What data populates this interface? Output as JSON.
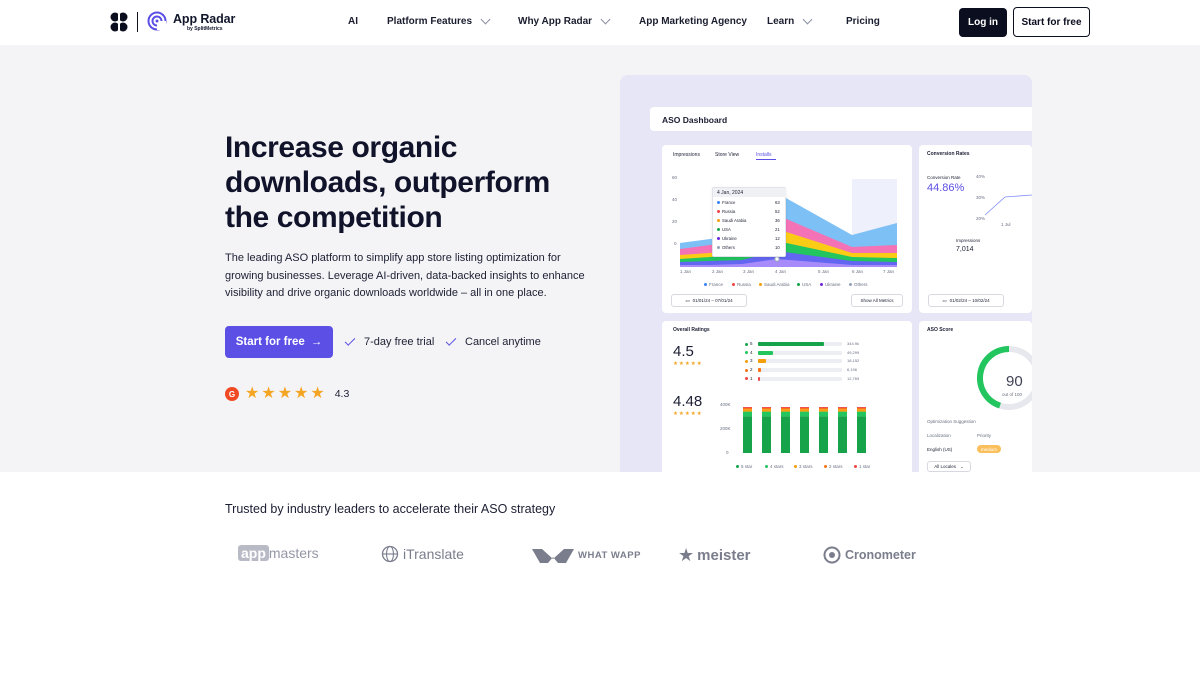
{
  "nav": {
    "brand": "App Radar",
    "brand_sub": "by SplitMetrics",
    "items": [
      {
        "label": "AI"
      },
      {
        "label": "Platform Features"
      },
      {
        "label": "Why App Radar"
      },
      {
        "label": "App Marketing Agency"
      },
      {
        "label": "Learn"
      },
      {
        "label": "Pricing"
      }
    ],
    "login": "Log in",
    "start": "Start for free"
  },
  "hero": {
    "title": "Increase organic downloads, outperform the competition",
    "description": "The leading ASO platform to simplify app store listing optimization for growing businesses. Leverage AI-driven, data-backed insights to enhance visibility and drive organic downloads worldwide – all in one place.",
    "cta": "Start for free",
    "cta_arrow": "→",
    "checks": [
      "7-day free trial",
      "Cancel anytime"
    ],
    "rating_badge": "G",
    "rating": "4.3",
    "stars": 5
  },
  "dashboard": {
    "title": "ASO Dashboard",
    "tabs": [
      "Impressions",
      "Store View",
      "Installs"
    ],
    "active_tab": "Installs",
    "tooltip": {
      "date": "4 Jan, 2024",
      "rows": [
        {
          "country": "France",
          "value": "63",
          "color": "#3b82f6"
        },
        {
          "country": "Russia",
          "value": "52",
          "color": "#ef4444"
        },
        {
          "country": "Saudi Arabia",
          "value": "36",
          "color": "#f59e0b"
        },
        {
          "country": "USA",
          "value": "21",
          "color": "#16a34a"
        },
        {
          "country": "Ukraine",
          "value": "12",
          "color": "#6d28d9"
        },
        {
          "country": "Others",
          "value": "10",
          "color": "#94a3b8"
        }
      ]
    },
    "area_yticks": [
      "60",
      "40",
      "20",
      "0"
    ],
    "area_xticks": [
      "1 Jan",
      "2 Jan",
      "3 Jan",
      "4 Jan",
      "5 Jan",
      "6 Jan",
      "7 Jan"
    ],
    "area_legend": [
      {
        "name": "France",
        "color": "#3b82f6"
      },
      {
        "name": "Russia",
        "color": "#ef4444"
      },
      {
        "name": "Saudi Arabia",
        "color": "#f59e0b"
      },
      {
        "name": "USA",
        "color": "#16a34a"
      },
      {
        "name": "Ukraine",
        "color": "#6d28d9"
      },
      {
        "name": "Others",
        "color": "#94a3b8"
      }
    ],
    "date_range": "01/01/24 – 07/01/24",
    "show_all": "Show All Metrics",
    "conversion": {
      "title": "Conversion Rates",
      "label": "Conversion Rate",
      "value": "44.86%",
      "yticks": [
        "40%",
        "30%",
        "20%"
      ],
      "xtick": "1 Jul",
      "impressions_label": "Impressions",
      "impressions_value": "7,014",
      "date_range": "01/02/24 – 10/02/24"
    },
    "ratings": {
      "title": "Overall Ratings",
      "score": "4.5",
      "score2": "4.48",
      "rows": [
        {
          "star": "5",
          "count": "344.9k",
          "fill": 0.78,
          "color": "#16a34a"
        },
        {
          "star": "4",
          "count": "49,299",
          "fill": 0.18,
          "color": "#22c55e"
        },
        {
          "star": "3",
          "count": "18,152",
          "fill": 0.1,
          "color": "#f59e0b"
        },
        {
          "star": "2",
          "count": "6,196",
          "fill": 0.04,
          "color": "#f97316"
        },
        {
          "star": "1",
          "count": "12,769",
          "fill": 0.02,
          "color": "#ef4444"
        }
      ],
      "bar_yticks": [
        "400K",
        "200K",
        "0"
      ],
      "bar_legend": [
        {
          "name": "5 star",
          "color": "#16a34a"
        },
        {
          "name": "4 stars",
          "color": "#22c55e"
        },
        {
          "name": "3 stars",
          "color": "#f59e0b"
        },
        {
          "name": "2 stars",
          "color": "#f97316"
        },
        {
          "name": "1 star",
          "color": "#ef4444"
        }
      ]
    },
    "aso_score": {
      "title": "ASO Score",
      "value": "90",
      "sub": "out of 100",
      "fill": 0.9,
      "suggestion": "Optimization Suggestion",
      "col1": "Localization",
      "col2": "Priority",
      "row_locale": "English (US)",
      "row_priority": "medium",
      "filter": "All Locales"
    }
  },
  "trusted": {
    "heading": "Trusted by industry leaders to accelerate their ASO strategy",
    "logos": [
      "appmasters",
      "iTranslate",
      "WHAT WAPP",
      "meister",
      "Cronometer"
    ]
  },
  "colors": {
    "accent": "#5b4fe6",
    "dark": "#0b0e1f",
    "hero_bg": "#f4f4f6",
    "dash_bg": "#e7e6f7",
    "star": "#f5a524"
  }
}
